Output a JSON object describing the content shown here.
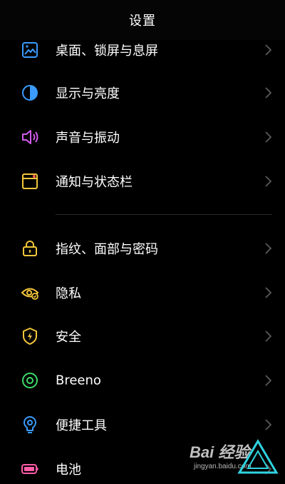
{
  "header": {
    "title": "设置"
  },
  "items": [
    {
      "label": "桌面、锁屏与息屏",
      "icon": "wallpaper-icon",
      "color": "#3b9bff"
    },
    {
      "label": "显示与亮度",
      "icon": "brightness-icon",
      "color": "#3b9bff"
    },
    {
      "label": "声音与振动",
      "icon": "speaker-icon",
      "color": "#d35cf0"
    },
    {
      "label": "通知与状态栏",
      "icon": "notification-icon",
      "color": "#f4c63a"
    },
    {
      "label": "指纹、面部与密码",
      "icon": "lock-icon",
      "color": "#f4c63a"
    },
    {
      "label": "隐私",
      "icon": "privacy-eye-icon",
      "color": "#f4c63a"
    },
    {
      "label": "安全",
      "icon": "security-shield-icon",
      "color": "#f4c63a"
    },
    {
      "label": "Breeno",
      "icon": "breeno-icon",
      "color": "#3ddc6a"
    },
    {
      "label": "便捷工具",
      "icon": "convenience-tools-icon",
      "color": "#3b9bff"
    },
    {
      "label": "电池",
      "icon": "battery-icon",
      "color": "#ff5ca8"
    }
  ],
  "watermark": {
    "logo": "Bai 经验",
    "url": "jingyan.baidu.com"
  }
}
